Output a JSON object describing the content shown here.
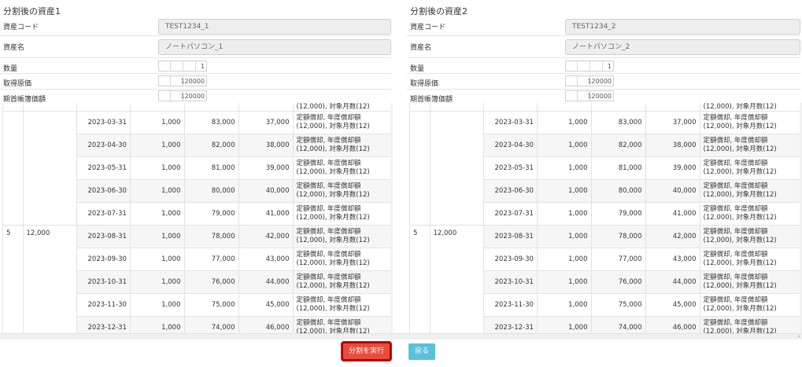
{
  "panels": [
    {
      "title": "分割後の資産1",
      "asset_code": {
        "label": "資産コード",
        "value": "TEST1234_1"
      },
      "asset_name": {
        "label": "資産名",
        "value": "ノートパソコン_1"
      },
      "quantity": {
        "label": "数量",
        "value": "1"
      },
      "acquisition_cost": {
        "label": "取得原価",
        "value": "120000"
      },
      "opening_book_value": {
        "label": "期首帳簿価額",
        "value": "120000"
      }
    },
    {
      "title": "分割後の資産2",
      "asset_code": {
        "label": "資産コード",
        "value": "TEST1234_2"
      },
      "asset_name": {
        "label": "資産名",
        "value": "ノートパソコン_2"
      },
      "quantity": {
        "label": "数量",
        "value": "1"
      },
      "acquisition_cost": {
        "label": "取得原価",
        "value": "120000"
      },
      "opening_book_value": {
        "label": "期首帳簿価額",
        "value": "120000"
      }
    }
  ],
  "schedule": {
    "top_partial_desc": "(12,000), 対象月数(12)",
    "desc_line1": "定額償却, 年度償却額",
    "desc_line2": "(12,000), 対象月数(12)",
    "group_period": "5",
    "group_amount": "12,000",
    "rows": [
      {
        "date": "2023-03-31",
        "monthly": "1,000",
        "book": "83,000",
        "accum": "37,000"
      },
      {
        "date": "2023-04-30",
        "monthly": "1,000",
        "book": "82,000",
        "accum": "38,000"
      },
      {
        "date": "2023-05-31",
        "monthly": "1,000",
        "book": "81,000",
        "accum": "39,000"
      },
      {
        "date": "2023-06-30",
        "monthly": "1,000",
        "book": "80,000",
        "accum": "40,000"
      },
      {
        "date": "2023-07-31",
        "monthly": "1,000",
        "book": "79,000",
        "accum": "41,000"
      },
      {
        "date": "2023-08-31",
        "monthly": "1,000",
        "book": "78,000",
        "accum": "42,000"
      },
      {
        "date": "2023-09-30",
        "monthly": "1,000",
        "book": "77,000",
        "accum": "43,000"
      },
      {
        "date": "2023-10-31",
        "monthly": "1,000",
        "book": "76,000",
        "accum": "44,000"
      },
      {
        "date": "2023-11-30",
        "monthly": "1,000",
        "book": "75,000",
        "accum": "45,000"
      },
      {
        "date": "2023-12-31",
        "monthly": "1,000",
        "book": "74,000",
        "accum": "46,000"
      }
    ]
  },
  "buttons": {
    "execute_label": "分割を実行",
    "back_label": "戻る"
  },
  "colors": {
    "execute_bg": "#e74c3c",
    "back_bg": "#5bc0de"
  }
}
